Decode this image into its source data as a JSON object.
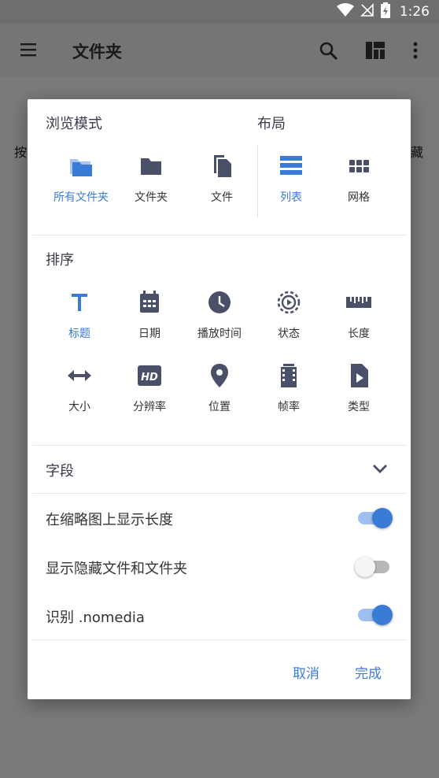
{
  "status": {
    "time": "1:26"
  },
  "appbar": {
    "title": "文件夹"
  },
  "background": {
    "left_text": "按",
    "right_text": "藏"
  },
  "dialog": {
    "browse": {
      "title": "浏览模式",
      "options": [
        {
          "label": "所有文件夹",
          "icon": "all-folders-icon",
          "active": true
        },
        {
          "label": "文件夹",
          "icon": "folder-icon",
          "active": false
        },
        {
          "label": "文件",
          "icon": "files-icon",
          "active": false
        }
      ]
    },
    "layout": {
      "title": "布局",
      "options": [
        {
          "label": "列表",
          "icon": "list-icon",
          "active": true
        },
        {
          "label": "网格",
          "icon": "grid-icon",
          "active": false
        }
      ]
    },
    "sort": {
      "title": "排序",
      "options": [
        {
          "label": "标题",
          "icon": "title-icon",
          "active": true
        },
        {
          "label": "日期",
          "icon": "calendar-icon",
          "active": false
        },
        {
          "label": "播放时间",
          "icon": "clock-icon",
          "active": false
        },
        {
          "label": "状态",
          "icon": "status-icon",
          "active": false
        },
        {
          "label": "长度",
          "icon": "ruler-icon",
          "active": false
        },
        {
          "label": "大小",
          "icon": "size-icon",
          "active": false
        },
        {
          "label": "分辨率",
          "icon": "hd-icon",
          "active": false
        },
        {
          "label": "位置",
          "icon": "location-icon",
          "active": false
        },
        {
          "label": "帧率",
          "icon": "film-icon",
          "active": false
        },
        {
          "label": "类型",
          "icon": "file-type-icon",
          "active": false
        }
      ]
    },
    "fields": {
      "title": "字段"
    },
    "toggles": [
      {
        "label": "在缩略图上显示长度",
        "on": true
      },
      {
        "label": "显示隐藏文件和文件夹",
        "on": false
      },
      {
        "label": "识别 .nomedia",
        "on": true
      }
    ],
    "buttons": {
      "cancel": "取消",
      "done": "完成"
    }
  },
  "colors": {
    "accent": "#3a7bd5",
    "icon": "#4a5068",
    "scrim": "#7a7a7a"
  }
}
